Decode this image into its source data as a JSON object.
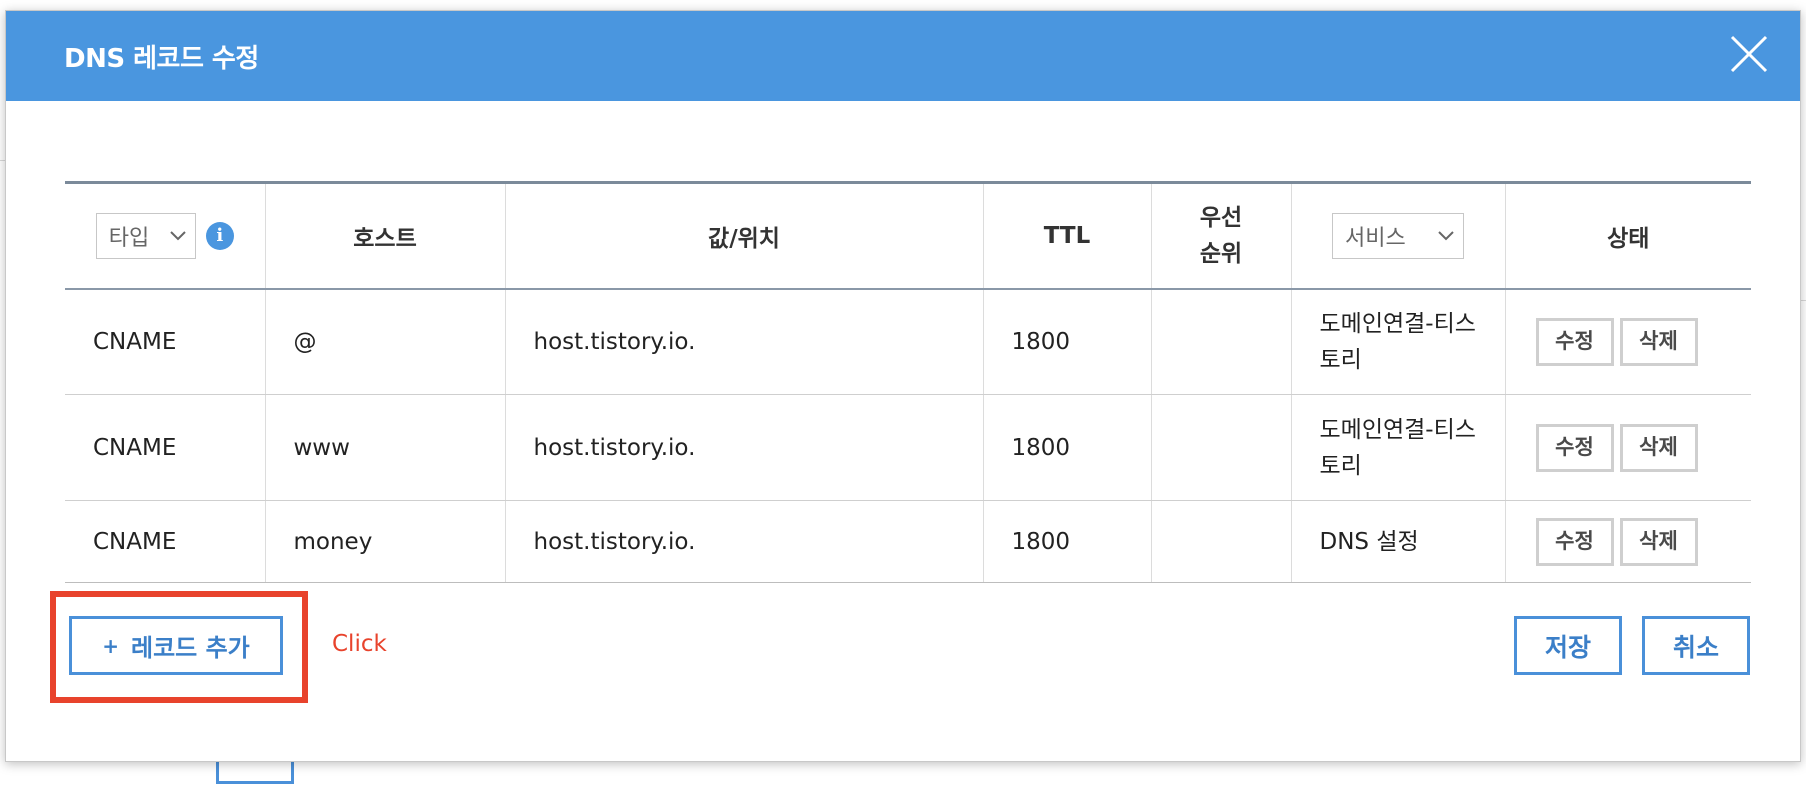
{
  "modal": {
    "title": "DNS 레코드 수정",
    "close_icon": "close-icon"
  },
  "table": {
    "headers": {
      "type_select": "타입",
      "host": "호스트",
      "value": "값/위치",
      "ttl": "TTL",
      "priority_line1": "우선",
      "priority_line2": "순위",
      "service_select": "서비스",
      "status": "상태"
    },
    "rows": [
      {
        "type": "CNAME",
        "host": "@",
        "value": "host.tistory.io.",
        "ttl": "1800",
        "priority": "",
        "service": "도메인연결-티스토리",
        "edit": "수정",
        "delete": "삭제"
      },
      {
        "type": "CNAME",
        "host": "www",
        "value": "host.tistory.io.",
        "ttl": "1800",
        "priority": "",
        "service": "도메인연결-티스토리",
        "edit": "수정",
        "delete": "삭제"
      },
      {
        "type": "CNAME",
        "host": "money",
        "value": "host.tistory.io.",
        "ttl": "1800",
        "priority": "",
        "service": "DNS 설정",
        "edit": "수정",
        "delete": "삭제"
      }
    ]
  },
  "footer": {
    "add_record_plus": "+",
    "add_record_label": "레코드 추가",
    "click_note": "Click",
    "save_label": "저장",
    "cancel_label": "취소"
  },
  "colors": {
    "header_bg": "#4a96df",
    "button_border": "#4a90d9",
    "highlight": "#e8432c"
  }
}
